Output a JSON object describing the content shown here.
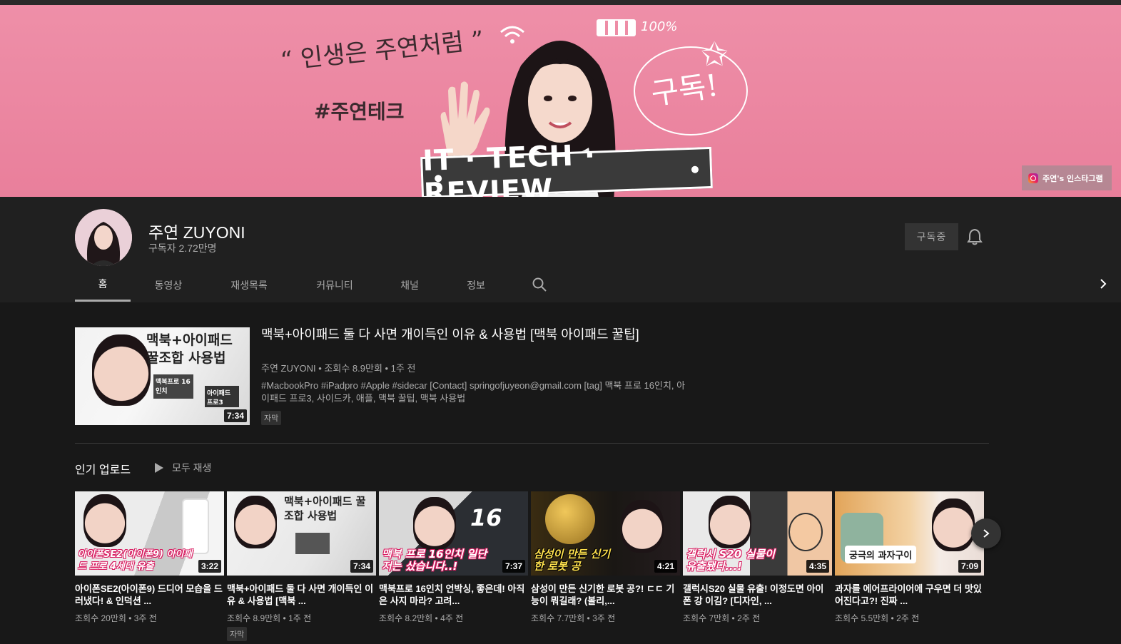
{
  "banner": {
    "quote": "“ 인생은 주연처럼 ”",
    "hashtag": "#주연테크",
    "subscribe_doodle": "구독!",
    "battery_text": "100%",
    "sign_text": "IT · TECH · REVIEW",
    "instagram_link": "주연's 인스타그램"
  },
  "channel": {
    "name": "주연 ZUYONI",
    "subscribers": "구독자 2.72만명",
    "subscribe_button": "구독중"
  },
  "tabs": [
    {
      "label": "홈"
    },
    {
      "label": "동영상"
    },
    {
      "label": "재생목록"
    },
    {
      "label": "커뮤니티"
    },
    {
      "label": "채널"
    },
    {
      "label": "정보"
    }
  ],
  "featured": {
    "title": "맥북+아이패드 둘 다 사면 개이득인 이유 & 사용법 [맥북 아이패드 꿀팁]",
    "meta": "주연 ZUYONI • 조회수 8.9만회 • 1주 전",
    "description": "#MacbookPro #iPadpro #Apple #sidecar [Contact] springofjuyeon@gmail.com [tag] 맥북 프로 16인치, 아이패드 프로3, 사이드카, 애플, 맥북 꿀팁, 맥북 사용법",
    "badge": "자막",
    "duration": "7:34",
    "thumb_text_1": "맥북+아이패드",
    "thumb_text_2": "꿀조합 사용법",
    "thumb_label_1": "맥북프로 16인치",
    "thumb_label_2": "아이패드 프로3"
  },
  "shelf": {
    "title": "인기 업로드",
    "play_all": "모두 재생",
    "videos": [
      {
        "title": "아이폰SE2(아이폰9) 드디어 모습을 드러냈다! & 인덕션 ...",
        "meta": "조회수 20만회 • 3주 전",
        "duration": "3:22",
        "overlay": "아이폰SE2(아이폰9) 아이패드 프로 4세대 유출",
        "badge": ""
      },
      {
        "title": "맥북+아이패드 둘 다 사면 개이득인 이유 & 사용법 [맥북 ...",
        "meta": "조회수 8.9만회 • 1주 전",
        "duration": "7:34",
        "overlay": "맥북+아이패드 꿀조합 사용법",
        "badge": "자막"
      },
      {
        "title": "맥북프로 16인치 언박싱, 좋은데! 아직은 사지 마라? 고려...",
        "meta": "조회수 8.2만회 • 4주 전",
        "duration": "7:37",
        "overlay": "맥북 프로 16인치 일단 저는 샀습니다..!",
        "badge": ""
      },
      {
        "title": "삼성이 만든 신기한 로봇 공?! ㄷㄷ 기능이 뭐길래? (볼리,...",
        "meta": "조회수 7.7만회 • 3주 전",
        "duration": "4:21",
        "overlay": "삼성이 만든 신기한 로봇 공",
        "badge": ""
      },
      {
        "title": "갤럭시S20 실물 유출! 이정도면 아이폰 강 이김? [디자인, ...",
        "meta": "조회수 7만회 • 2주 전",
        "duration": "4:35",
        "overlay": "갤럭시 S20 실물이 유출됐다...!",
        "badge": ""
      },
      {
        "title": "과자를 에어프라이어에 구우면 더 맛있어진다고?! 진짜 ...",
        "meta": "조회수 5.5만회 • 2주 전",
        "duration": "7:09",
        "overlay": "궁극의 과자구이",
        "badge": ""
      }
    ]
  }
}
